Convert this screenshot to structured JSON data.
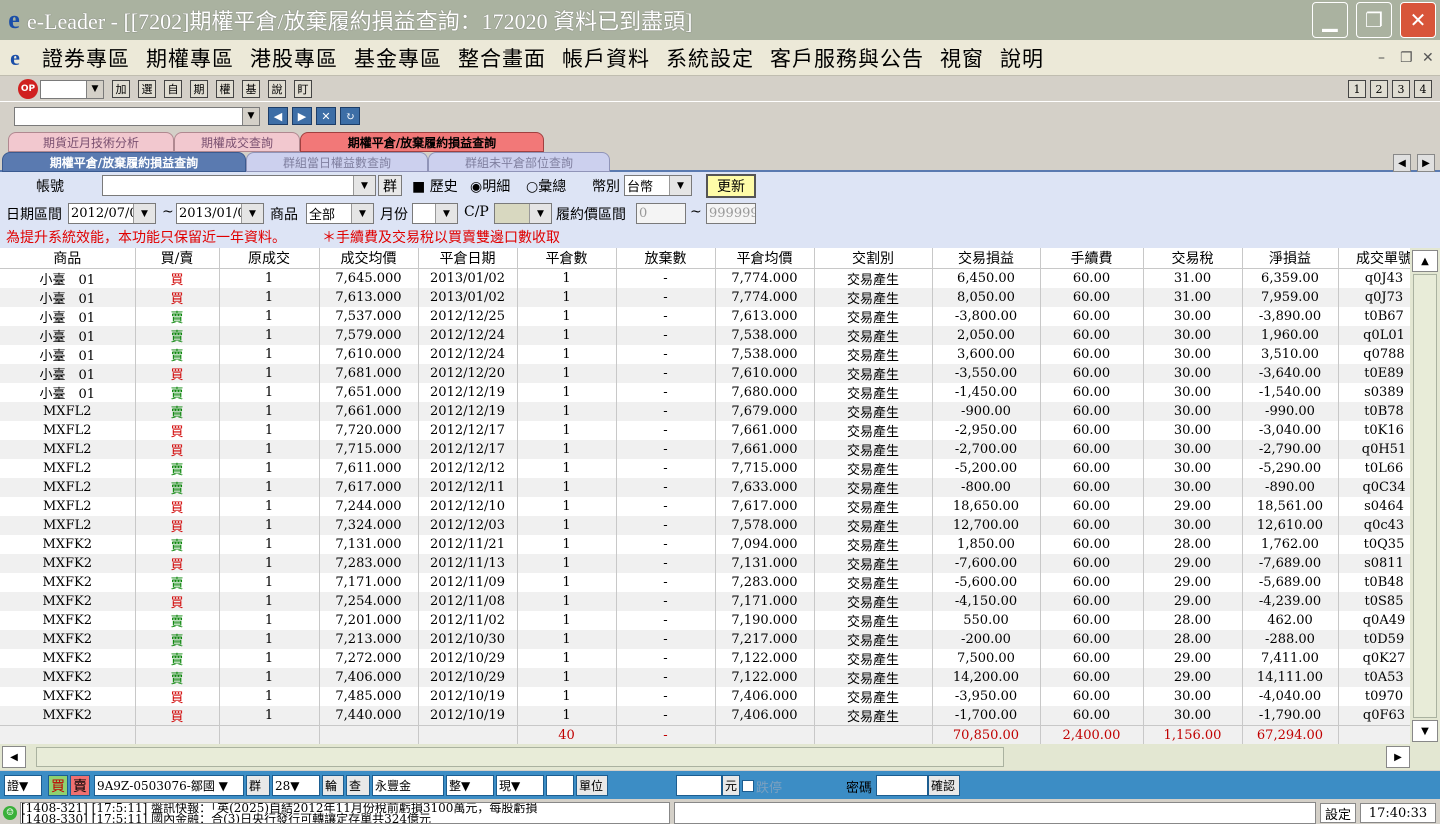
{
  "window": {
    "title": "e-Leader - [[7202]期權平倉/放棄履約損益查詢：172020 資料已到盡頭]"
  },
  "menu": [
    "證券專區",
    "期權專區",
    "港股專區",
    "基金專區",
    "整合畫面",
    "帳戶資料",
    "系統設定",
    "客戶服務與公告",
    "視窗",
    "說明"
  ],
  "toolbar": {
    "buttons": [
      "加",
      "選",
      "自",
      "期",
      "權",
      "基",
      "說",
      "盯"
    ],
    "pages": [
      "1",
      "2",
      "3",
      "4"
    ]
  },
  "tabs_row1": [
    "期貨近月技術分析",
    "期權成交查詢",
    "期權平倉/放棄履約損益查詢"
  ],
  "tabs_row2": [
    "期權平倉/放棄履約損益查詢",
    "群組當日權益數查詢",
    "群組未平倉部位查詢"
  ],
  "form": {
    "account_label": "帳號",
    "group_btn": "群",
    "history_label": "歷史",
    "detail_label": "明細",
    "summary_label": "彙總",
    "currency_label": "幣別",
    "currency": "台幣",
    "refresh": "更新",
    "date_label": "日期區間",
    "date_from": "2012/07/0",
    "date_sep": "~",
    "date_to": "2013/01/0",
    "product_label": "商品",
    "product": "全部",
    "month_label": "月份",
    "cp_label": "C/P",
    "strike_label": "履約價區間",
    "strike_from": "0",
    "strike_to": "999999",
    "note1": "為提升系統效能，本功能只保留近一年資料。",
    "note2": "＊手續費及交易稅以買賣雙邊口數收取"
  },
  "columns": [
    "商品",
    "買/賣",
    "原成交",
    "成交均價",
    "平倉日期",
    "平倉數",
    "放棄數",
    "平倉均價",
    "交割別",
    "交易損益",
    "手續費",
    "交易稅",
    "淨損益",
    "成交單號"
  ],
  "rows": [
    [
      "小臺　01",
      "買",
      "1",
      "7,645.000",
      "2013/01/02",
      "1",
      "-",
      "7,774.000",
      "交易產生",
      "6,450.00",
      "60.00",
      "31.00",
      "6,359.00",
      "q0J43"
    ],
    [
      "小臺　01",
      "買",
      "1",
      "7,613.000",
      "2013/01/02",
      "1",
      "-",
      "7,774.000",
      "交易產生",
      "8,050.00",
      "60.00",
      "31.00",
      "7,959.00",
      "q0J73"
    ],
    [
      "小臺　01",
      "賣",
      "1",
      "7,537.000",
      "2012/12/25",
      "1",
      "-",
      "7,613.000",
      "交易產生",
      "-3,800.00",
      "60.00",
      "30.00",
      "-3,890.00",
      "t0B67"
    ],
    [
      "小臺　01",
      "賣",
      "1",
      "7,579.000",
      "2012/12/24",
      "1",
      "-",
      "7,538.000",
      "交易產生",
      "2,050.00",
      "60.00",
      "30.00",
      "1,960.00",
      "q0L01"
    ],
    [
      "小臺　01",
      "賣",
      "1",
      "7,610.000",
      "2012/12/24",
      "1",
      "-",
      "7,538.000",
      "交易產生",
      "3,600.00",
      "60.00",
      "30.00",
      "3,510.00",
      "q0788"
    ],
    [
      "小臺　01",
      "買",
      "1",
      "7,681.000",
      "2012/12/20",
      "1",
      "-",
      "7,610.000",
      "交易產生",
      "-3,550.00",
      "60.00",
      "30.00",
      "-3,640.00",
      "t0E89"
    ],
    [
      "小臺　01",
      "賣",
      "1",
      "7,651.000",
      "2012/12/19",
      "1",
      "-",
      "7,680.000",
      "交易產生",
      "-1,450.00",
      "60.00",
      "30.00",
      "-1,540.00",
      "s0389"
    ],
    [
      "MXFL2",
      "賣",
      "1",
      "7,661.000",
      "2012/12/19",
      "1",
      "-",
      "7,679.000",
      "交易產生",
      "-900.00",
      "60.00",
      "30.00",
      "-990.00",
      "t0B78"
    ],
    [
      "MXFL2",
      "買",
      "1",
      "7,720.000",
      "2012/12/17",
      "1",
      "-",
      "7,661.000",
      "交易產生",
      "-2,950.00",
      "60.00",
      "30.00",
      "-3,040.00",
      "t0K16"
    ],
    [
      "MXFL2",
      "買",
      "1",
      "7,715.000",
      "2012/12/17",
      "1",
      "-",
      "7,661.000",
      "交易產生",
      "-2,700.00",
      "60.00",
      "30.00",
      "-2,790.00",
      "q0H51"
    ],
    [
      "MXFL2",
      "賣",
      "1",
      "7,611.000",
      "2012/12/12",
      "1",
      "-",
      "7,715.000",
      "交易產生",
      "-5,200.00",
      "60.00",
      "30.00",
      "-5,290.00",
      "t0L66"
    ],
    [
      "MXFL2",
      "賣",
      "1",
      "7,617.000",
      "2012/12/11",
      "1",
      "-",
      "7,633.000",
      "交易產生",
      "-800.00",
      "60.00",
      "30.00",
      "-890.00",
      "q0C34"
    ],
    [
      "MXFL2",
      "買",
      "1",
      "7,244.000",
      "2012/12/10",
      "1",
      "-",
      "7,617.000",
      "交易產生",
      "18,650.00",
      "60.00",
      "29.00",
      "18,561.00",
      "s0464"
    ],
    [
      "MXFL2",
      "買",
      "1",
      "7,324.000",
      "2012/12/03",
      "1",
      "-",
      "7,578.000",
      "交易產生",
      "12,700.00",
      "60.00",
      "30.00",
      "12,610.00",
      "q0c43"
    ],
    [
      "MXFK2",
      "賣",
      "1",
      "7,131.000",
      "2012/11/21",
      "1",
      "-",
      "7,094.000",
      "交易產生",
      "1,850.00",
      "60.00",
      "28.00",
      "1,762.00",
      "t0Q35"
    ],
    [
      "MXFK2",
      "買",
      "1",
      "7,283.000",
      "2012/11/13",
      "1",
      "-",
      "7,131.000",
      "交易產生",
      "-7,600.00",
      "60.00",
      "29.00",
      "-7,689.00",
      "s0811"
    ],
    [
      "MXFK2",
      "賣",
      "1",
      "7,171.000",
      "2012/11/09",
      "1",
      "-",
      "7,283.000",
      "交易產生",
      "-5,600.00",
      "60.00",
      "29.00",
      "-5,689.00",
      "t0B48"
    ],
    [
      "MXFK2",
      "買",
      "1",
      "7,254.000",
      "2012/11/08",
      "1",
      "-",
      "7,171.000",
      "交易產生",
      "-4,150.00",
      "60.00",
      "29.00",
      "-4,239.00",
      "t0S85"
    ],
    [
      "MXFK2",
      "賣",
      "1",
      "7,201.000",
      "2012/11/02",
      "1",
      "-",
      "7,190.000",
      "交易產生",
      "550.00",
      "60.00",
      "28.00",
      "462.00",
      "q0A49"
    ],
    [
      "MXFK2",
      "賣",
      "1",
      "7,213.000",
      "2012/10/30",
      "1",
      "-",
      "7,217.000",
      "交易產生",
      "-200.00",
      "60.00",
      "28.00",
      "-288.00",
      "t0D59"
    ],
    [
      "MXFK2",
      "賣",
      "1",
      "7,272.000",
      "2012/10/29",
      "1",
      "-",
      "7,122.000",
      "交易產生",
      "7,500.00",
      "60.00",
      "29.00",
      "7,411.00",
      "q0K27"
    ],
    [
      "MXFK2",
      "賣",
      "1",
      "7,406.000",
      "2012/10/29",
      "1",
      "-",
      "7,122.000",
      "交易產生",
      "14,200.00",
      "60.00",
      "29.00",
      "14,111.00",
      "t0A53"
    ],
    [
      "MXFK2",
      "買",
      "1",
      "7,485.000",
      "2012/10/19",
      "1",
      "-",
      "7,406.000",
      "交易產生",
      "-3,950.00",
      "60.00",
      "30.00",
      "-4,040.00",
      "t0970"
    ],
    [
      "MXFK2",
      "買",
      "1",
      "7,440.000",
      "2012/10/19",
      "1",
      "-",
      "7,406.000",
      "交易產生",
      "-1,700.00",
      "60.00",
      "30.00",
      "-1,790.00",
      "q0F63"
    ]
  ],
  "totals": [
    "",
    "",
    "",
    "",
    "",
    "40",
    "-",
    "",
    "",
    "70,850.00",
    "2,400.00",
    "1,156.00",
    "67,294.00",
    ""
  ],
  "orderbar": {
    "mode": "證",
    "buy": "買",
    "sell": "賣",
    "account": "9A9Z-0503076-鄒國",
    "group": "群",
    "num": "28",
    "turn": "輪",
    "query": "查",
    "name": "永豐金",
    "whole": "整",
    "cur": "現",
    "unit": "單位",
    "yuan": "元",
    "stop": "跌停",
    "password": "密碼",
    "confirm": "確認"
  },
  "status": {
    "news1": "[1408-321] [17:5:11] 盤訊快報：「英(2025)自結2012年11月份稅前虧損3100萬元，每股虧損",
    "news2": "[1408-330] [17:5:11] 國內金融：合(3)日央行發行可轉讓定存單共324億元",
    "settings": "設定",
    "time": "17:40:33"
  }
}
